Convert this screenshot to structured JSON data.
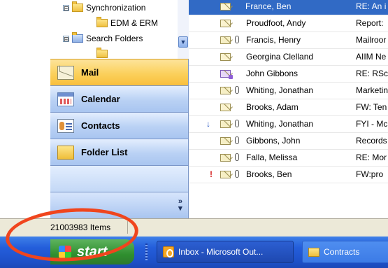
{
  "folder_tree": {
    "items": [
      {
        "label": "Synchronization",
        "expander": "⊟",
        "type": "folder"
      },
      {
        "label": "EDM & ERM",
        "type": "folder"
      },
      {
        "label": "Search Folders",
        "expander": "⊟",
        "type": "search-folder"
      }
    ]
  },
  "nav": {
    "mail": "Mail",
    "calendar": "Calendar",
    "contacts": "Contacts",
    "folder_list": "Folder List",
    "chevron": "»"
  },
  "messages": [
    {
      "from": "France, Ben",
      "subject": "RE: An i",
      "attachment": false,
      "icon": "open",
      "flag": "",
      "selected": true
    },
    {
      "from": "Proudfoot, Andy",
      "subject": "Report:",
      "attachment": false,
      "icon": "open",
      "flag": ""
    },
    {
      "from": "Francis, Henry",
      "subject": "Mailroor",
      "attachment": true,
      "icon": "envelope",
      "flag": ""
    },
    {
      "from": "Georgina Clelland",
      "subject": "AIIM Ne",
      "attachment": false,
      "icon": "open",
      "flag": ""
    },
    {
      "from": "John Gibbons",
      "subject": "RE: RSc",
      "attachment": false,
      "icon": "meeting",
      "flag": ""
    },
    {
      "from": "Whiting, Jonathan",
      "subject": "Marketin",
      "attachment": true,
      "icon": "envelope",
      "flag": ""
    },
    {
      "from": "Brooks, Adam",
      "subject": "FW: Ten",
      "attachment": false,
      "icon": "open",
      "flag": ""
    },
    {
      "from": "Whiting, Jonathan",
      "subject": "FYI - Mc",
      "attachment": true,
      "icon": "envelope",
      "flag": "↓"
    },
    {
      "from": "Gibbons, John",
      "subject": "Records",
      "attachment": true,
      "icon": "envelope",
      "flag": ""
    },
    {
      "from": "Falla, Melissa",
      "subject": "RE: Mor",
      "attachment": true,
      "icon": "envelope",
      "flag": ""
    },
    {
      "from": "Brooks, Ben",
      "subject": "FW:pro",
      "attachment": true,
      "icon": "envelope",
      "flag": "!"
    }
  ],
  "status": {
    "items_count": "21003983 Items"
  },
  "taskbar": {
    "start": "start",
    "tasks": [
      {
        "label": "Inbox - Microsoft Out...",
        "icon": "outlook-icon",
        "active": true
      },
      {
        "label": "Contracts",
        "icon": "folder-icon",
        "active": false
      }
    ]
  },
  "colors": {
    "selection": "#316ac5",
    "nav_selected": "#fbd05c",
    "annotation": "#f0451d"
  }
}
